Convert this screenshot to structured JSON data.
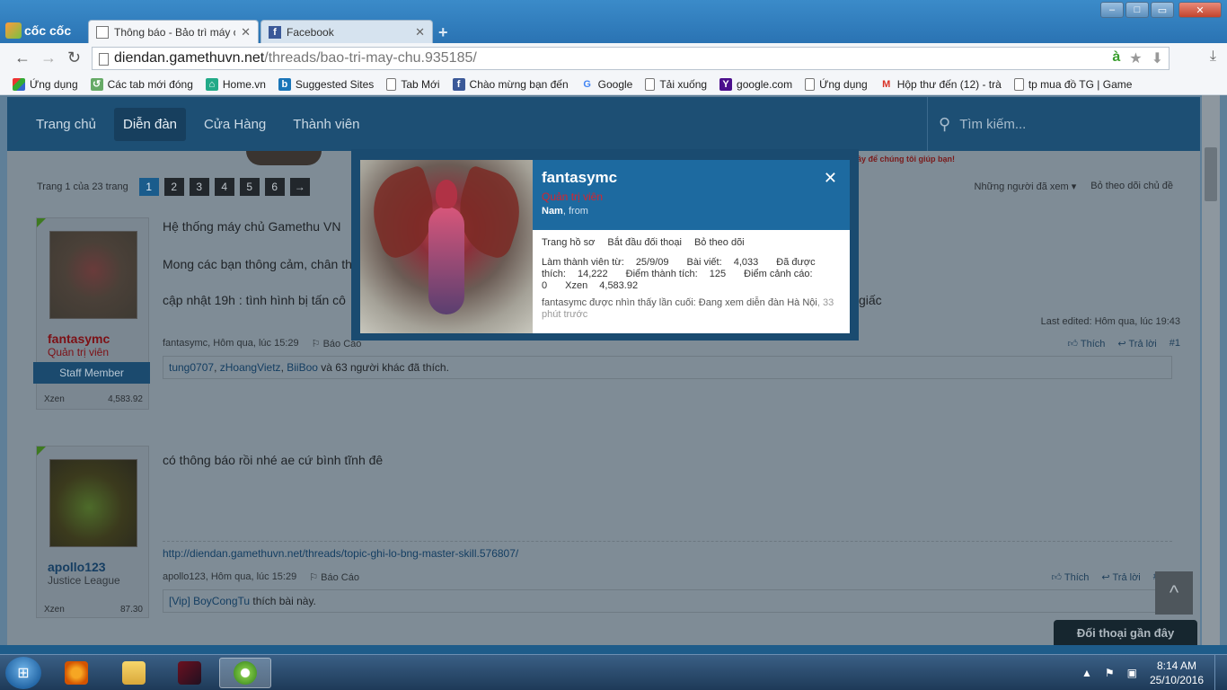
{
  "browser": {
    "logo": "cốc cốc",
    "tabs": [
      {
        "label": "Thông báo - Bảo trì máy ch",
        "active": true
      },
      {
        "label": "Facebook",
        "active": false
      }
    ],
    "new_tab": "+",
    "window_buttons": [
      "–",
      "□",
      "✕"
    ],
    "url_domain": "diendan.gamethuvn.net",
    "url_path": "/threads/bao-tri-may-chu.935185/",
    "addr_green_icon": "à",
    "bookmarks": [
      {
        "label": "Ứng dụng",
        "icon": "apps-grid-icon"
      },
      {
        "label": "Các tab mới đóng",
        "icon": "coccoc-icon"
      },
      {
        "label": "Home.vn",
        "icon": "home-icon"
      },
      {
        "label": "Suggested Sites",
        "icon": "bing-icon"
      },
      {
        "label": "Tab Mới",
        "icon": "page-icon"
      },
      {
        "label": "Chào mừng bạn đến",
        "icon": "facebook-icon"
      },
      {
        "label": "Google",
        "icon": "google-icon"
      },
      {
        "label": "Tải xuống",
        "icon": "page-icon"
      },
      {
        "label": "google.com",
        "icon": "yahoo-icon"
      },
      {
        "label": "Ứng dụng",
        "icon": "page-icon"
      },
      {
        "label": "Hộp thư đến (12) - trà",
        "icon": "gmail-icon"
      },
      {
        "label": "tp mua đồ TG | Game",
        "icon": "page-icon"
      }
    ]
  },
  "forum": {
    "nav": [
      "Trang chủ",
      "Diễn đàn",
      "Cửa Hàng",
      "Thành viên"
    ],
    "search_placeholder": "Tìm kiếm...",
    "banner_text": "ây để chúng tôi giúp bạn!",
    "pager": {
      "label": "Trang 1 của 23 trang",
      "pages": [
        "1",
        "2",
        "3",
        "4",
        "5",
        "6"
      ],
      "next": "→"
    },
    "watchers": {
      "viewers": "Những người đã xem",
      "unfollow": "Bỏ theo dõi chủ đề"
    },
    "posts": [
      {
        "username": "fantasymc",
        "role": "Quản trị viên",
        "staff_badge": "Staff Member",
        "xzen_label": "Xzen",
        "xzen_value": "4,583.92",
        "lines": [
          "Hệ thống máy chủ Gamethu VN",
          "Mong các bạn thông cảm, chân th",
          "cập nhật 19h : tình hình bị tấn cô"
        ],
        "trailing": "giấc",
        "last_edited": "Last edited: Hôm qua, lúc 19:43",
        "meta_author": "fantasymc, Hôm qua, lúc 15:29",
        "report": "Báo Cáo",
        "like": "Thích",
        "reply": "Trả lời",
        "number": "#1",
        "likes_users": [
          "tung0707",
          "zHoangVietz",
          "BiiBoo"
        ],
        "likes_rest": " và 63 người khác đã thích."
      },
      {
        "username": "apollo123",
        "role": "Justice League",
        "xzen_label": "Xzen",
        "xzen_value": "87.30",
        "lines": [
          "có thông báo rồi nhé ae cứ bình tĩnh đê"
        ],
        "signature": "http://diendan.gamethuvn.net/threads/topic-ghi-lo-bng-master-skill.576807/",
        "meta_author": "apollo123, Hôm qua, lúc 15:29",
        "report": "Báo Cáo",
        "like": "Thích",
        "reply": "Trả lời",
        "number": "#2",
        "likes_users": [
          "[Vip] BoyCongTu"
        ],
        "likes_rest": " thích bài này."
      }
    ],
    "chat_bar": "Đối thoại gần đây",
    "scroll_top_icon": "^"
  },
  "popup": {
    "name": "fantasymc",
    "role": "Quản trị viên",
    "gender": "Nam",
    "from": "from",
    "links": [
      "Trang hồ sơ",
      "Bắt đầu đối thoại",
      "Bỏ theo dõi"
    ],
    "stats": {
      "joined_label": "Làm thành viên từ:",
      "joined": "25/9/09",
      "posts_label": "Bài viết:",
      "posts": "4,033",
      "likes_label": "Đã được thích:",
      "likes": "14,222",
      "points_label": "Điểm thành tích:",
      "points": "125",
      "warnings_label": "Điểm cảnh cáo:",
      "warnings": "0",
      "xzen_label": "Xzen",
      "xzen": "4,583.92"
    },
    "last_seen": "fantasymc được nhìn thấy lần cuối: Đang xem diễn đàn Hà Nội",
    "last_seen_time": ", 33 phút trước",
    "close": "✕"
  },
  "taskbar": {
    "time": "8:14 AM",
    "date": "25/10/2016"
  }
}
